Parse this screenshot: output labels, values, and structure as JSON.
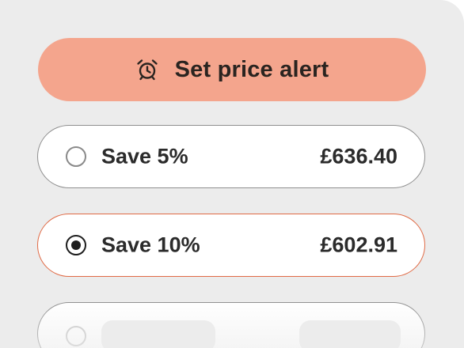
{
  "alert_button": {
    "icon": "alarm-clock-icon",
    "label": "Set price alert",
    "color": "#f4a58d"
  },
  "options": [
    {
      "label": "Save 5%",
      "price": "£636.40",
      "selected": false
    },
    {
      "label": "Save 10%",
      "price": "£602.91",
      "selected": true
    },
    {
      "label": "",
      "price": "",
      "selected": false,
      "loading": true
    }
  ],
  "colors": {
    "background": "#ececec",
    "accent": "#e06a45",
    "text": "#2b2b2b"
  }
}
